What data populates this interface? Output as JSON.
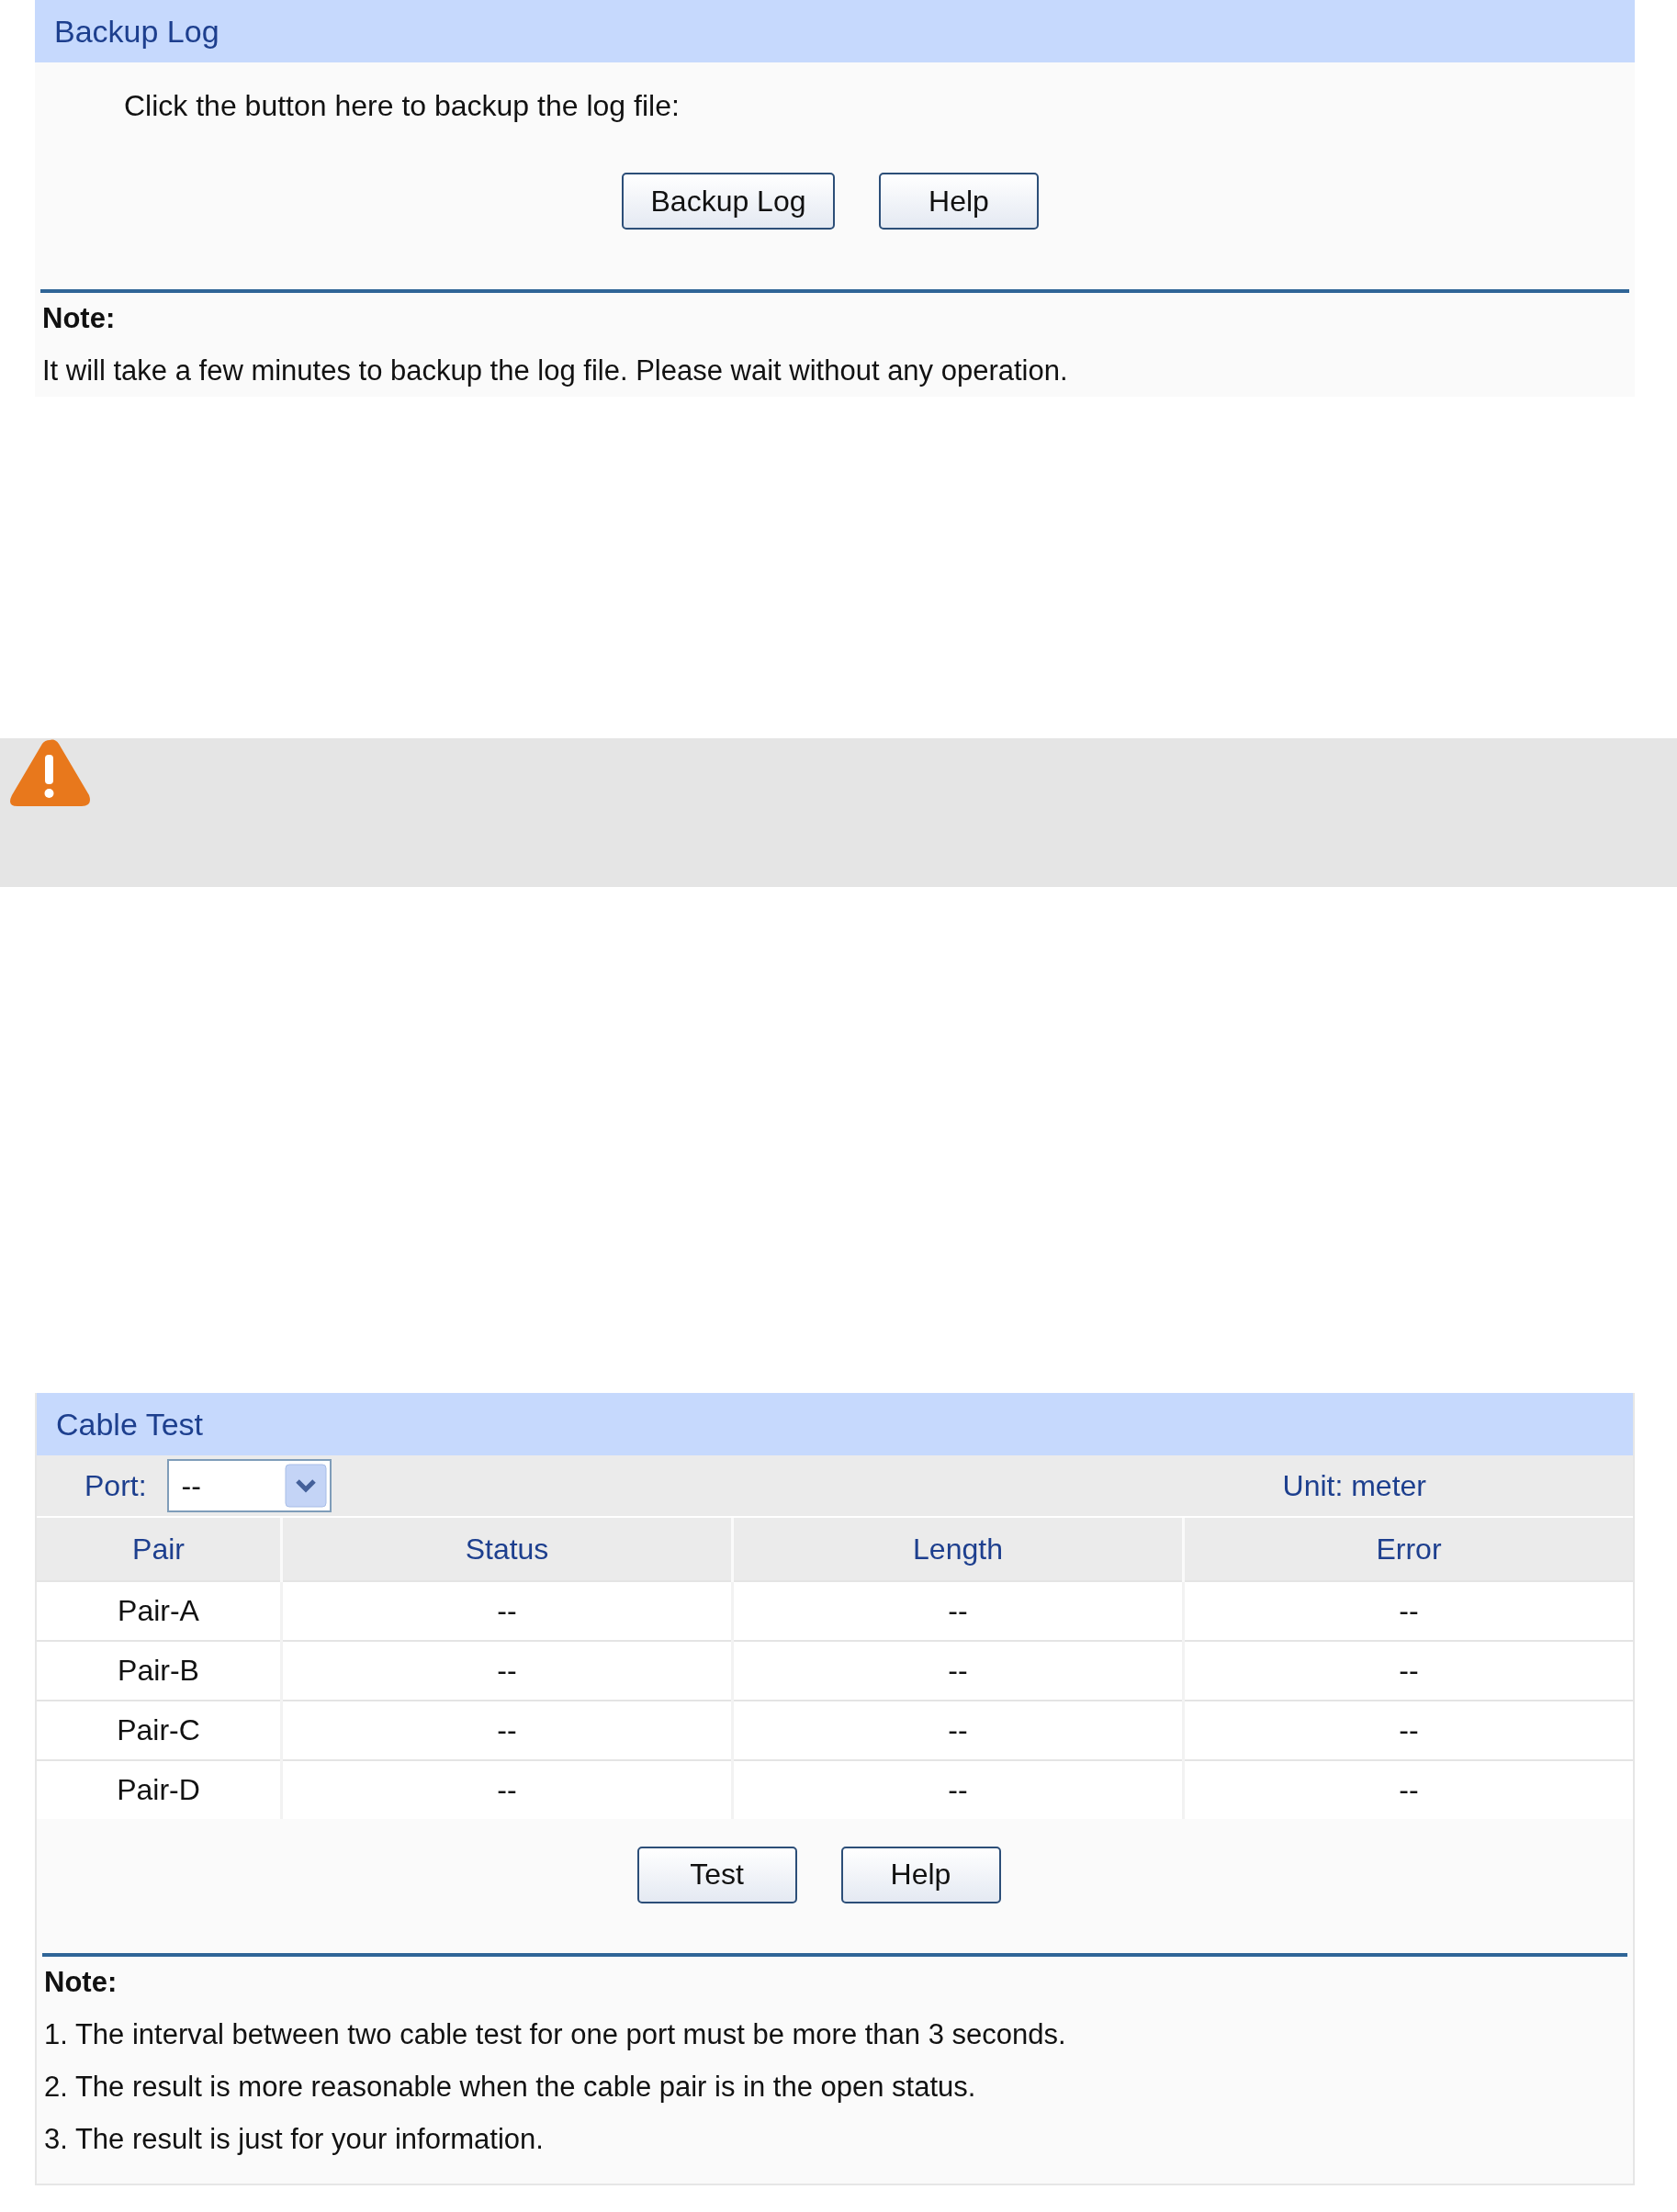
{
  "backup_log": {
    "title": "Backup Log",
    "instruction": "Click the button here to backup the log file:",
    "buttons": [
      "Backup Log",
      "Help"
    ],
    "note": {
      "heading": "Note:",
      "lines": [
        "It will take a few minutes to backup the log file. Please wait without any operation."
      ]
    }
  },
  "cable_test": {
    "title": "Cable Test",
    "port": {
      "label": "Port:",
      "value": "--"
    },
    "unit": "Unit: meter",
    "table": {
      "columns": [
        "Pair",
        "Status",
        "Length",
        "Error"
      ],
      "rows": [
        [
          "Pair-A",
          "--",
          "--",
          "--"
        ],
        [
          "Pair-B",
          "--",
          "--",
          "--"
        ],
        [
          "Pair-C",
          "--",
          "--",
          "--"
        ],
        [
          "Pair-D",
          "--",
          "--",
          "--"
        ]
      ]
    },
    "buttons": [
      "Test",
      "Help"
    ],
    "note": {
      "heading": "Note:",
      "lines": [
        "1. The interval between two cable test for one port must be more than 3 seconds.",
        "2. The result is more reasonable when the cable pair is in the open status.",
        "3. The result is just for your information."
      ]
    }
  }
}
